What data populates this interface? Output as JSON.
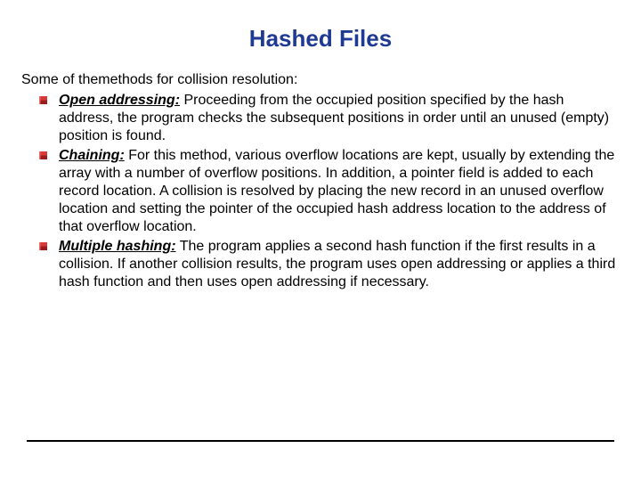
{
  "title": "Hashed Files",
  "intro": "Some of themethods for collision resolution:",
  "items": [
    {
      "term": "Open addressing:",
      "desc": " Proceeding from the occupied position specified by the hash address, the program checks the subsequent positions in order until an unused (empty) position is found."
    },
    {
      "term": "Chaining:",
      "desc": " For this method, various overflow locations are kept, usually by extending the array with a number of overflow positions. In addition, a pointer field is added to each record location. A collision is resolved by placing the new record in an unused overflow location and setting the pointer of the occupied hash address location to the address of that overflow location."
    },
    {
      "term": "Multiple hashing:",
      "desc": " The program applies a second hash function if the first results in a collision. If another collision results, the program uses open addressing or applies a third hash function and then uses open addressing if necessary."
    }
  ]
}
